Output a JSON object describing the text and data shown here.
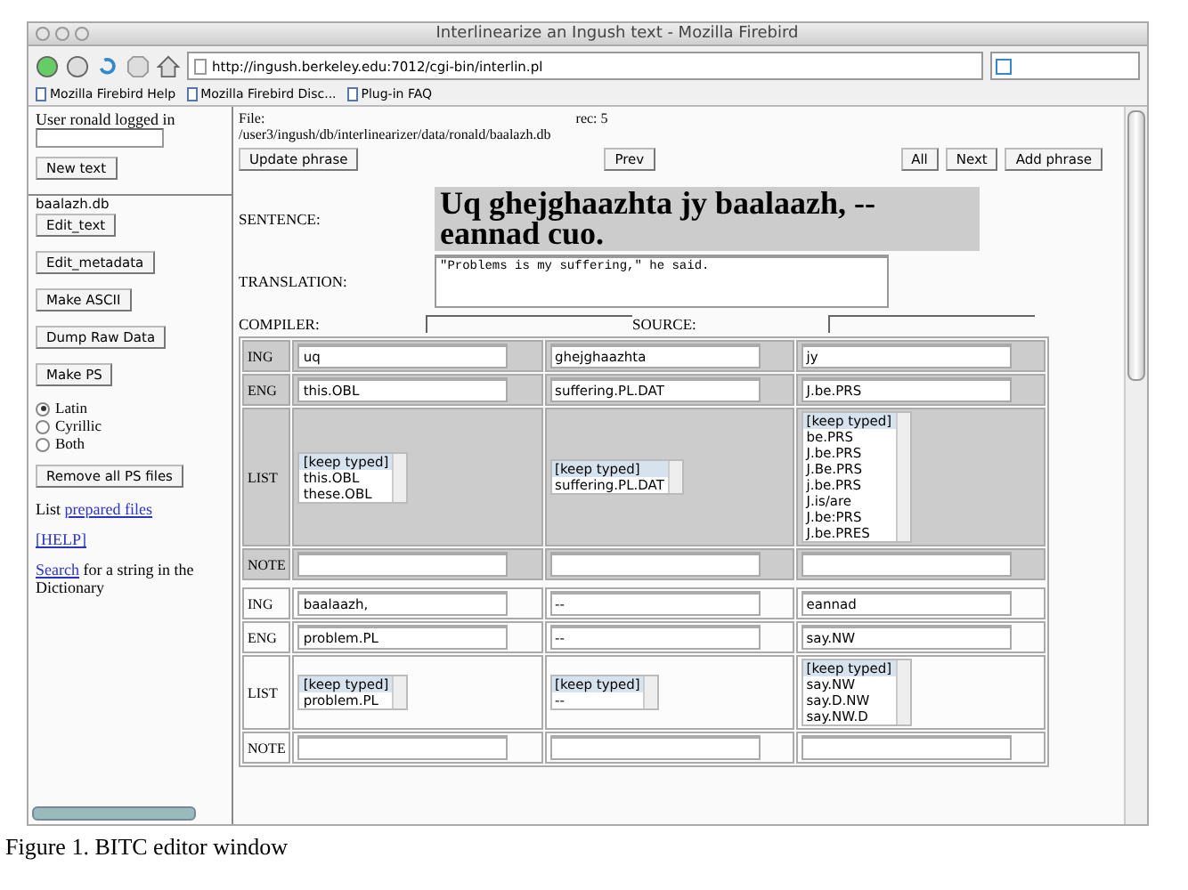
{
  "window": {
    "title": "Interlinearize an Ingush text - Mozilla Firebird"
  },
  "toolbar": {
    "url": "http://ingush.berkeley.edu:7012/cgi-bin/interlin.pl"
  },
  "bookmarks": [
    "Mozilla Firebird Help",
    "Mozilla Firebird Disc...",
    "Plug-in FAQ"
  ],
  "sidebar": {
    "user_text": "User ronald logged in",
    "new_text_button": "New text",
    "file_name": "baalazh.db",
    "buttons": [
      "Edit_text",
      "Edit_metadata",
      "Make ASCII",
      "Dump Raw Data",
      "Make PS"
    ],
    "radios": [
      {
        "label": "Latin",
        "selected": true
      },
      {
        "label": "Cyrillic",
        "selected": false
      },
      {
        "label": "Both",
        "selected": false
      }
    ],
    "remove_button": "Remove all PS files",
    "list_text": "List",
    "list_link": "prepared files",
    "help_link": "[HELP]",
    "search_link": "Search",
    "search_text": "for a string in the Dictionary"
  },
  "main": {
    "file_label": "File:",
    "file_path": "/user3/ingush/db/interlinearizer/data/ronald/baalazh.db",
    "rec": "rec: 5",
    "left_buttons": [
      "Update phrase"
    ],
    "middle_buttons": [
      "Prev"
    ],
    "right_buttons": [
      "All",
      "Next",
      "Add phrase"
    ],
    "sentence_label": "SENTENCE:",
    "sentence": "Uq ghejghaazhta jy baalaazh, -- eannad cuo.",
    "translation_label": "TRANSLATION:",
    "translation": "\"Problems is my suffering,\" he said.",
    "compiler_label": "COMPILER:",
    "source_label": "SOURCE:",
    "groups": [
      {
        "shaded": true,
        "labels": {
          "ing": "ING",
          "eng": "ENG",
          "list": "LIST",
          "note": "NOTE"
        },
        "words": [
          {
            "ing": "uq",
            "eng": "this.OBL",
            "options": [
              {
                "text": "[keep typed]",
                "selected": true
              },
              {
                "text": "this.OBL",
                "selected": false
              },
              {
                "text": "these.OBL",
                "selected": false
              }
            ]
          },
          {
            "ing": "ghejghaazhta",
            "eng": "suffering.PL.DAT",
            "options": [
              {
                "text": "[keep typed]",
                "selected": true
              },
              {
                "text": "suffering.PL.DAT",
                "selected": false
              }
            ]
          },
          {
            "ing": "jy",
            "eng": "J.be.PRS",
            "options": [
              {
                "text": "[keep typed]",
                "selected": true
              },
              {
                "text": "be.PRS",
                "selected": false
              },
              {
                "text": "J.be.PRS",
                "selected": false
              },
              {
                "text": "J.Be.PRS",
                "selected": false
              },
              {
                "text": "j.be.PRS",
                "selected": false
              },
              {
                "text": "J.is/are",
                "selected": false
              },
              {
                "text": "J.be:PRS",
                "selected": false
              },
              {
                "text": "J.be.PRES",
                "selected": false
              }
            ]
          }
        ]
      },
      {
        "shaded": false,
        "labels": {
          "ing": "ING",
          "eng": "ENG",
          "list": "LIST",
          "note": "NOTE"
        },
        "words": [
          {
            "ing": "baalaazh,",
            "eng": "problem.PL",
            "options": [
              {
                "text": "[keep typed]",
                "selected": true
              },
              {
                "text": "problem.PL",
                "selected": false
              }
            ]
          },
          {
            "ing": "--",
            "eng": "--",
            "options": [
              {
                "text": "[keep typed]",
                "selected": true
              },
              {
                "text": "--",
                "selected": false
              }
            ]
          },
          {
            "ing": "eannad",
            "eng": "say.NW",
            "options": [
              {
                "text": "[keep typed]",
                "selected": true
              },
              {
                "text": "say.NW",
                "selected": false
              },
              {
                "text": "say.D.NW",
                "selected": false
              },
              {
                "text": "say.NW.D",
                "selected": false
              }
            ]
          }
        ]
      }
    ]
  },
  "caption": "Figure 1. BITC editor window"
}
